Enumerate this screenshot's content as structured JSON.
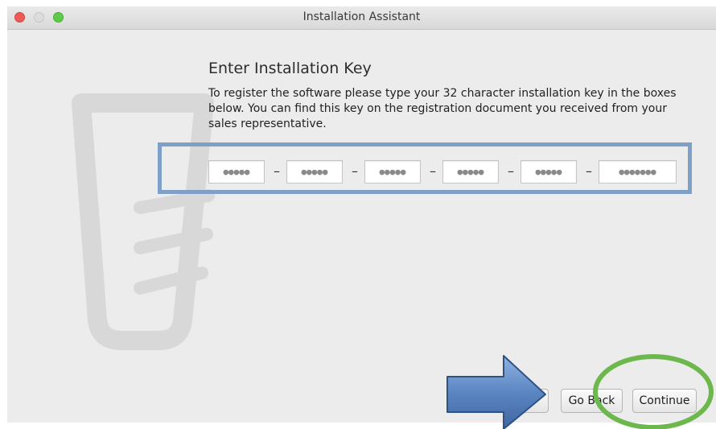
{
  "window": {
    "title": "Installation Assistant",
    "controls": [
      "close-icon",
      "minimize-icon",
      "zoom-icon"
    ]
  },
  "content": {
    "heading": "Enter Installation Key",
    "description": "To register the software please type your 32 character installation key in the boxes below. You can find this key on the registration document you received from your sales representative."
  },
  "key_fields": {
    "placeholders": [
      "●●●●●",
      "●●●●●",
      "●●●●●",
      "●●●●●",
      "●●●●●",
      "●●●●●●●"
    ],
    "separator": "–"
  },
  "buttons": {
    "back": "Go Back",
    "continue": "Continue"
  },
  "annotations": {
    "highlight_color": "#7e9fc8",
    "arrow_color": "#5b86c2",
    "circle_color": "#6db84d"
  }
}
